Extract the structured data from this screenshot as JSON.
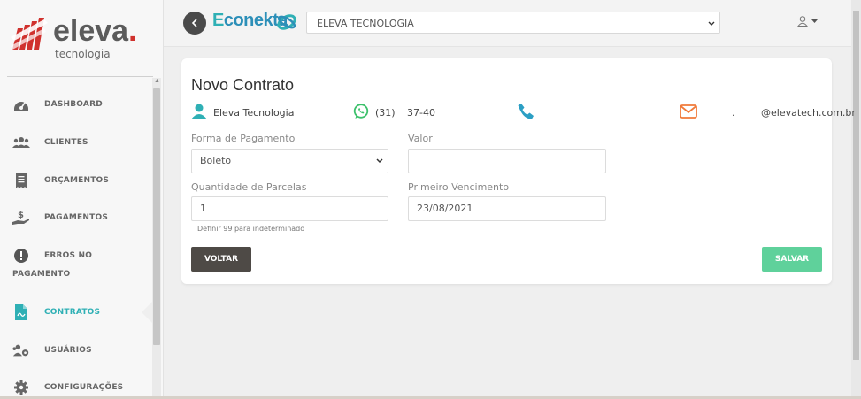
{
  "logo": {
    "name": "eleva",
    "dot": ".",
    "sub": "tecnologia"
  },
  "header": {
    "brand_first": "E",
    "brand_rest": "conekta",
    "company_selected": "ELEVA TECNOLOGIA"
  },
  "sidebar": {
    "items": [
      {
        "label": "DASHBOARD",
        "icon": "dashboard-icon"
      },
      {
        "label": "CLIENTES",
        "icon": "users-icon"
      },
      {
        "label": "ORÇAMENTOS",
        "icon": "receipt-icon"
      },
      {
        "label": "PAGAMENTOS",
        "icon": "money-hand-icon"
      },
      {
        "label_line1": "ERROS NO",
        "label_line2": "PAGAMENTO",
        "icon": "alert-circle-icon"
      },
      {
        "label": "CONTRATOS",
        "icon": "contract-icon",
        "active": true
      },
      {
        "label": "USUÁRIOS",
        "icon": "users-gear-icon"
      },
      {
        "label": "CONFIGURAÇÕES",
        "icon": "gear-icon"
      }
    ]
  },
  "card": {
    "title": "Novo Contrato",
    "client_name": "Eleva Tecnologia",
    "whatsapp_ddd": "(31)",
    "whatsapp_number": "37-40",
    "email_prefix": ".",
    "email_domain": "@elevatech.com.br",
    "form": {
      "payment_label": "Forma de Pagamento",
      "payment_value": "Boleto",
      "value_label": "Valor",
      "value_value": "",
      "installments_label": "Quantidade de Parcelas",
      "installments_value": "1",
      "installments_hint": "Definir 99 para indeterminado",
      "due_label": "Primeiro Vencimento",
      "due_value": "23/08/2021"
    },
    "back_label": "VOLTAR",
    "save_label": "SALVAR"
  },
  "colors": {
    "accent_teal": "#2fb0b5",
    "brand_blue": "#2c8fb8",
    "logo_red": "#d0312d",
    "save_green": "#5fd19b",
    "whatsapp_green": "#3cc16b",
    "email_orange": "#f07a3a"
  }
}
